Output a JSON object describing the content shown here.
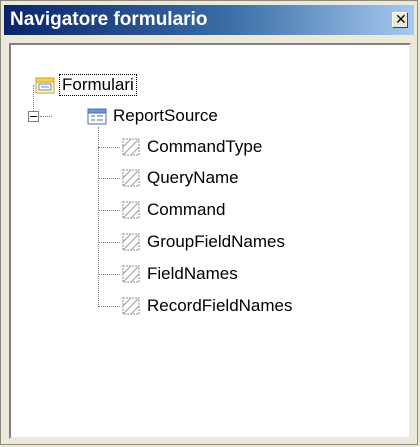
{
  "window": {
    "title": "Navigatore formulario",
    "close_glyph": "✕"
  },
  "tree": {
    "root": {
      "label": "Formulari",
      "icon": "forms-folder-icon"
    },
    "form": {
      "label": "ReportSource",
      "icon": "form-icon",
      "expanded": true
    },
    "fields": [
      {
        "label": "CommandType",
        "icon": "hidden-control-icon"
      },
      {
        "label": "QueryName",
        "icon": "hidden-control-icon"
      },
      {
        "label": "Command",
        "icon": "hidden-control-icon"
      },
      {
        "label": "GroupFieldNames",
        "icon": "hidden-control-icon"
      },
      {
        "label": "FieldNames",
        "icon": "hidden-control-icon"
      },
      {
        "label": "RecordFieldNames",
        "icon": "hidden-control-icon"
      }
    ]
  }
}
